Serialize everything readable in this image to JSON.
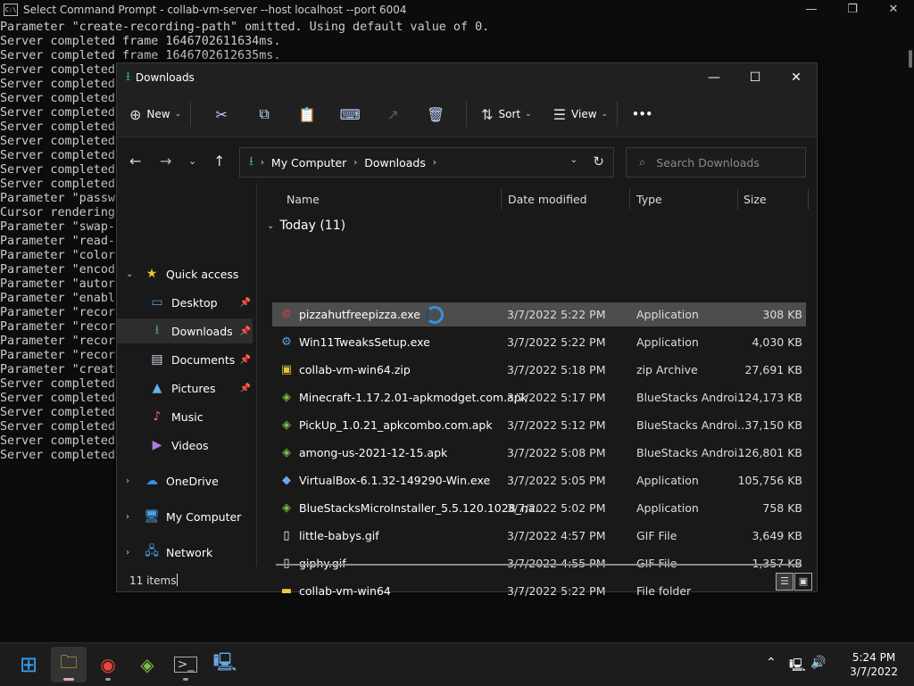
{
  "cmd": {
    "title": "Select Command Prompt - collab-vm-server  --host localhost --port 6004",
    "lines": [
      "Parameter \"create-recording-path\" omitted. Using default value of 0.",
      "Server completed frame 1646702611634ms.",
      "Server completed frame 1646702612635ms.",
      "Server completed",
      "Server completed",
      "Server completed",
      "Server completed",
      "Server completed",
      "Server completed",
      "Server completed",
      "Server completed",
      "Server completed",
      "Parameter \"passw",
      "Cursor rendering",
      "Parameter \"swap-",
      "Parameter \"read-",
      "Parameter \"color",
      "Parameter \"encod",
      "Parameter \"autor",
      "Parameter \"enabl",
      "Parameter \"recor",
      "Parameter \"recor",
      "Parameter \"recor",
      "Parameter \"recor",
      "Parameter \"creat",
      "Server completed",
      "Server completed",
      "Server completed",
      "Server completed",
      "Server completed",
      "Server completed"
    ]
  },
  "explorer": {
    "title": "Downloads",
    "toolbar": {
      "new_label": "New",
      "sort_label": "Sort",
      "view_label": "View",
      "more_label": "•••"
    },
    "address": {
      "segments": [
        "My Computer",
        "Downloads"
      ]
    },
    "search_placeholder": "Search Downloads",
    "sidebar": [
      {
        "label": "Quick access",
        "icon": "star-icon"
      },
      {
        "label": "Desktop",
        "icon": "desktop-icon"
      },
      {
        "label": "Downloads",
        "icon": "download-icon"
      },
      {
        "label": "Documents",
        "icon": "documents-icon"
      },
      {
        "label": "Pictures",
        "icon": "pictures-icon"
      },
      {
        "label": "Music",
        "icon": "music-icon"
      },
      {
        "label": "Videos",
        "icon": "videos-icon"
      },
      {
        "label": "OneDrive",
        "icon": "cloud-icon"
      },
      {
        "label": "My Computer",
        "icon": "computer-icon"
      },
      {
        "label": "Network",
        "icon": "network-icon"
      }
    ],
    "columns": [
      "Name",
      "Date modified",
      "Type",
      "Size"
    ],
    "group_label": "Today (11)",
    "files": [
      {
        "name": "pizzahutfreepizza.exe",
        "date": "3/7/2022 5:22 PM",
        "type": "Application",
        "size": "308 KB",
        "icon": "exe-icon"
      },
      {
        "name": "Win11TweaksSetup.exe",
        "date": "3/7/2022 5:22 PM",
        "type": "Application",
        "size": "4,030 KB",
        "icon": "setup-icon"
      },
      {
        "name": "collab-vm-win64.zip",
        "date": "3/7/2022 5:18 PM",
        "type": "zip Archive",
        "size": "27,691 KB",
        "icon": "zip-icon"
      },
      {
        "name": "Minecraft-1.17.2.01-apkmodget.com.apk",
        "date": "3/7/2022 5:17 PM",
        "type": "BlueStacks Androi...",
        "size": "124,173 KB",
        "icon": "bluestacks-icon"
      },
      {
        "name": "PickUp_1.0.21_apkcombo.com.apk",
        "date": "3/7/2022 5:12 PM",
        "type": "BlueStacks Androi...",
        "size": "37,150 KB",
        "icon": "bluestacks-icon"
      },
      {
        "name": "among-us-2021-12-15.apk",
        "date": "3/7/2022 5:08 PM",
        "type": "BlueStacks Androi...",
        "size": "126,801 KB",
        "icon": "bluestacks-icon"
      },
      {
        "name": "VirtualBox-6.1.32-149290-Win.exe",
        "date": "3/7/2022 5:05 PM",
        "type": "Application",
        "size": "105,756 KB",
        "icon": "virtualbox-icon"
      },
      {
        "name": "BlueStacksMicroInstaller_5.5.120.1028_na...",
        "date": "3/7/2022 5:02 PM",
        "type": "Application",
        "size": "758 KB",
        "icon": "bluestacks-icon"
      },
      {
        "name": "little-babys.gif",
        "date": "3/7/2022 4:57 PM",
        "type": "GIF File",
        "size": "3,649 KB",
        "icon": "file-icon"
      },
      {
        "name": "giphy.gif",
        "date": "3/7/2022 4:55 PM",
        "type": "GIF File",
        "size": "1,357 KB",
        "icon": "file-icon"
      },
      {
        "name": "collab-vm-win64",
        "date": "3/7/2022 5:22 PM",
        "type": "File folder",
        "size": "",
        "icon": "folder-icon"
      }
    ],
    "status": "11 items"
  },
  "taskbar": {
    "time": "5:24 PM",
    "date": "3/7/2022"
  }
}
